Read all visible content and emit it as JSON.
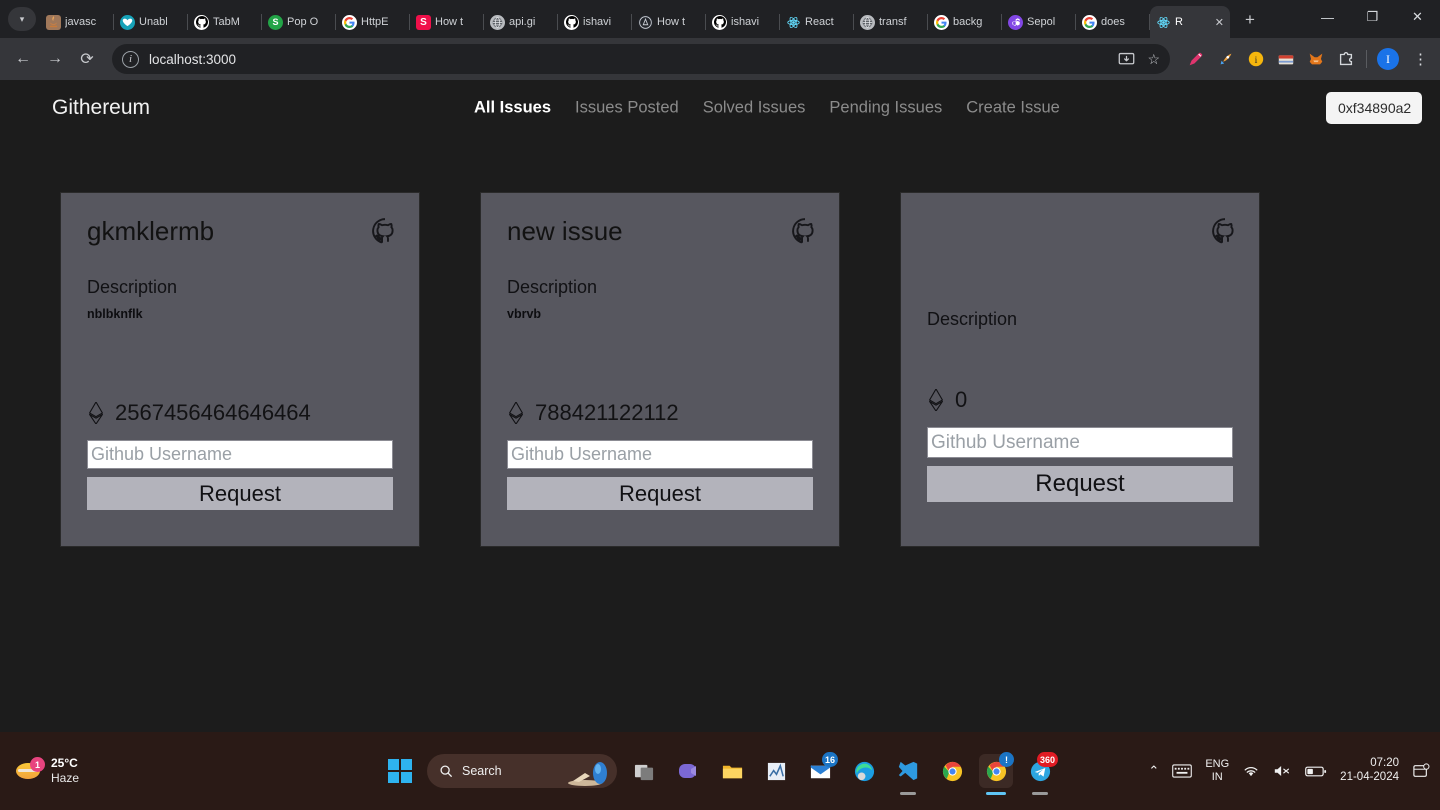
{
  "browser": {
    "tabs": [
      {
        "label": "javasc",
        "favicon": "java-icon",
        "active": false
      },
      {
        "label": "Unabl",
        "favicon": "teal-circle-icon",
        "active": false
      },
      {
        "label": "TabM",
        "favicon": "github-icon",
        "active": false
      },
      {
        "label": "Pop O",
        "favicon": "green-s-icon",
        "active": false
      },
      {
        "label": "HttpE",
        "favicon": "google-icon",
        "active": false
      },
      {
        "label": "How t",
        "favicon": "red-s-icon",
        "active": false
      },
      {
        "label": "api.gi",
        "favicon": "globe-icon",
        "active": false
      },
      {
        "label": "ishavi",
        "favicon": "github-icon",
        "active": false
      },
      {
        "label": "How t",
        "favicon": "dark-a-icon",
        "active": false
      },
      {
        "label": "ishavi",
        "favicon": "github-icon",
        "active": false
      },
      {
        "label": "React",
        "favicon": "react-icon",
        "active": false
      },
      {
        "label": "transf",
        "favicon": "globe-icon",
        "active": false
      },
      {
        "label": "backg",
        "favicon": "google-icon",
        "active": false
      },
      {
        "label": "Sepol",
        "favicon": "polygon-icon",
        "active": false
      },
      {
        "label": "does",
        "favicon": "google-icon",
        "active": false
      },
      {
        "label": "R",
        "favicon": "react-icon",
        "active": true
      }
    ],
    "tab_close_glyph": "✕",
    "new_tab_glyph": "+",
    "window_controls": {
      "minimize": "—",
      "maximize": "❐",
      "close": "✕"
    },
    "nav": {
      "back": "←",
      "forward": "→",
      "reload": "⟳"
    },
    "omnibox": {
      "url": "localhost:3000",
      "info_glyph": "i",
      "install_glyph": "⇱",
      "star_glyph": "☆"
    },
    "extensions": [
      "pen-icon",
      "rocket-icon",
      "info-badge-icon",
      "wallet-icon",
      "metamask-fox-icon",
      "puzzle-icon"
    ],
    "profile_initial": "I",
    "kebab_glyph": "⋮"
  },
  "site": {
    "brand": "Githereum",
    "nav_items": [
      {
        "label": "All Issues",
        "active": true
      },
      {
        "label": "Issues Posted",
        "active": false
      },
      {
        "label": "Solved Issues",
        "active": false
      },
      {
        "label": "Pending Issues",
        "active": false
      },
      {
        "label": "Create Issue",
        "active": false
      }
    ],
    "wallet_address": "0xf34890a2",
    "description_label": "Description",
    "username_placeholder": "Github Username",
    "request_label": "Request",
    "cards": [
      {
        "title": "gkmklermb",
        "description_label": "Description",
        "description": "nblbknflk",
        "amount": "2567456464646464",
        "username_placeholder": "Github Username",
        "request_label": "Request"
      },
      {
        "title": "new issue",
        "description_label": "Description",
        "description": "vbrvb",
        "amount": "788421122112",
        "username_placeholder": "Github Username",
        "request_label": "Request"
      },
      {
        "title": "",
        "description_label": "Description",
        "description": "",
        "amount": "0",
        "username_placeholder": "Github Username",
        "request_label": "Request"
      }
    ],
    "colors": {
      "page_bg": "#1c1c1c",
      "card_bg": "#57575f",
      "accent_text": "#ffffff",
      "muted_text": "#8b8b8b",
      "button_bg": "#b3b3bb"
    }
  },
  "taskbar": {
    "weather": {
      "temperature": "25°C",
      "condition": "Haze",
      "badge": "1"
    },
    "search_placeholder": "Search",
    "apps": [
      {
        "name": "task-view-icon",
        "badge": null
      },
      {
        "name": "teams-icon",
        "badge": null
      },
      {
        "name": "file-explorer-icon",
        "badge": null
      },
      {
        "name": "chart-app-icon",
        "badge": null
      },
      {
        "name": "mail-icon",
        "badge": "16"
      },
      {
        "name": "edge-icon",
        "badge": null
      },
      {
        "name": "vscode-icon",
        "badge": null
      },
      {
        "name": "chrome-icon",
        "badge": null
      },
      {
        "name": "chrome-active-icon",
        "badge": "!"
      },
      {
        "name": "telegram-icon",
        "badge": "360"
      }
    ],
    "tray": {
      "overflow_glyph": "⌃",
      "keyboard_glyph": "⌨",
      "language": "ENG",
      "region": "IN",
      "wifi_glyph": "wifi-icon",
      "volume_glyph": "mute-icon",
      "battery_glyph": "battery-icon",
      "time": "07:20",
      "date": "21-04-2024",
      "notification_glyph": "notification-icon"
    }
  }
}
